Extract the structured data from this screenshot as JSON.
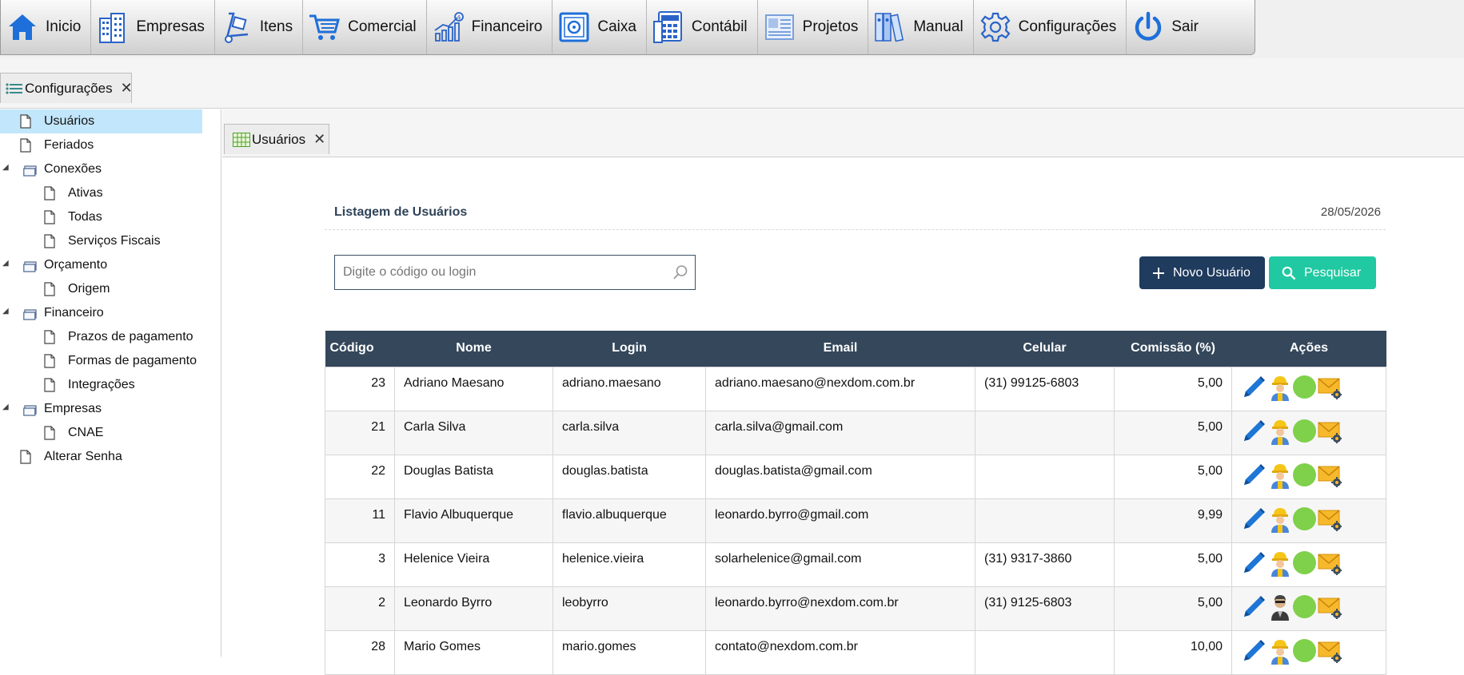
{
  "menu": [
    {
      "label": "Inicio",
      "icon": "home-icon"
    },
    {
      "label": "Empresas",
      "icon": "buildings-icon"
    },
    {
      "label": "Itens",
      "icon": "hand-truck-icon"
    },
    {
      "label": "Comercial",
      "icon": "cart-icon"
    },
    {
      "label": "Financeiro",
      "icon": "finance-chart-icon"
    },
    {
      "label": "Caixa",
      "icon": "safe-icon"
    },
    {
      "label": "Contábil",
      "icon": "calculator-icon"
    },
    {
      "label": "Projetos",
      "icon": "project-icon"
    },
    {
      "label": "Manual",
      "icon": "binders-icon"
    },
    {
      "label": "Configurações",
      "icon": "gear-icon"
    },
    {
      "label": "Sair",
      "icon": "power-icon"
    }
  ],
  "outer_tab": {
    "label": "Configurações"
  },
  "inner_tab": {
    "label": "Usuários"
  },
  "tree": [
    {
      "label": "Usuários",
      "type": "page",
      "level": 0,
      "selected": true
    },
    {
      "label": "Feriados",
      "type": "page",
      "level": 0
    },
    {
      "label": "Conexões",
      "type": "folder",
      "level": 0
    },
    {
      "label": "Ativas",
      "type": "page",
      "level": 1
    },
    {
      "label": "Todas",
      "type": "page",
      "level": 1
    },
    {
      "label": "Serviços Fiscais",
      "type": "page",
      "level": 1
    },
    {
      "label": "Orçamento",
      "type": "folder",
      "level": 0
    },
    {
      "label": "Origem",
      "type": "page",
      "level": 1
    },
    {
      "label": "Financeiro",
      "type": "folder",
      "level": 0
    },
    {
      "label": "Prazos de pagamento",
      "type": "page",
      "level": 1
    },
    {
      "label": "Formas de pagamento",
      "type": "page",
      "level": 1
    },
    {
      "label": "Integrações",
      "type": "page",
      "level": 1
    },
    {
      "label": "Empresas",
      "type": "folder",
      "level": 0
    },
    {
      "label": "CNAE",
      "type": "page",
      "level": 1
    },
    {
      "label": "Alterar Senha",
      "type": "page",
      "level": 0
    }
  ],
  "panel": {
    "title": "Listagem de Usuários",
    "date": "28/05/2026",
    "search_placeholder": "Digite o código ou login",
    "new_button": "Novo Usuário",
    "search_button": "Pesquisar"
  },
  "table": {
    "columns": [
      "Código",
      "Nome",
      "Login",
      "Email",
      "Celular",
      "Comissão (%)",
      "Ações"
    ],
    "rows": [
      {
        "codigo": "23",
        "nome": "Adriano Maesano",
        "login": "adriano.maesano",
        "email": "adriano.maesano@nexdom.com.br",
        "celular": "(31) 99125-6803",
        "comissao": "5,00",
        "avatar": "worker"
      },
      {
        "codigo": "21",
        "nome": "Carla Silva",
        "login": "carla.silva",
        "email": "carla.silva@gmail.com",
        "celular": "",
        "comissao": "5,00",
        "avatar": "worker"
      },
      {
        "codigo": "22",
        "nome": "Douglas Batista",
        "login": "douglas.batista",
        "email": "douglas.batista@gmail.com",
        "celular": "",
        "comissao": "5,00",
        "avatar": "worker"
      },
      {
        "codigo": "11",
        "nome": "Flavio Albuquerque",
        "login": "flavio.albuquerque",
        "email": "leonardo.byrro@gmail.com",
        "celular": "",
        "comissao": "9,99",
        "avatar": "worker"
      },
      {
        "codigo": "3",
        "nome": "Helenice Vieira",
        "login": "helenice.vieira",
        "email": "solarhelenice@gmail.com",
        "celular": "(31) 9317-3860",
        "comissao": "5,00",
        "avatar": "worker"
      },
      {
        "codigo": "2",
        "nome": "Leonardo Byrro",
        "login": "leobyrro",
        "email": "leonardo.byrro@nexdom.com.br",
        "celular": "(31) 9125-6803",
        "comissao": "5,00",
        "avatar": "admin"
      },
      {
        "codigo": "28",
        "nome": "Mario Gomes",
        "login": "mario.gomes",
        "email": "contato@nexdom.com.br",
        "celular": "",
        "comissao": "10,00",
        "avatar": "worker"
      }
    ]
  },
  "colors": {
    "header_bg": "#34475b",
    "primary_button": "#1f3b5e",
    "accent_button": "#20c9a2",
    "selected_tree": "#c2e6fb",
    "status_active": "#7fd04a"
  }
}
